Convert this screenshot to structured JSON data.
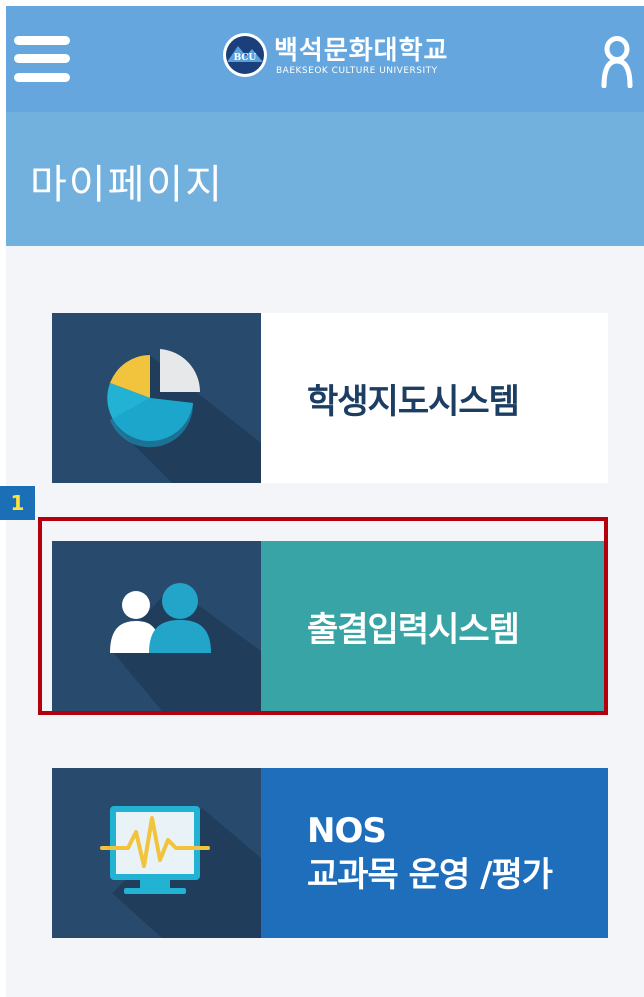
{
  "header": {
    "logo_name": "백석문화대학교",
    "logo_sub": "BAEKSEOK CULTURE UNIVERSITY",
    "logo_emblem_text": "BCU",
    "menu_icon": "hamburger-menu-icon",
    "user_icon": "user-profile-icon"
  },
  "page": {
    "title": "마이페이지"
  },
  "cards": [
    {
      "label": "학생지도시스템",
      "icon": "pie-chart-icon",
      "color": "#ffffff"
    },
    {
      "label": "출결입력시스템",
      "icon": "people-icon",
      "color": "#39a4a5"
    },
    {
      "label_line1": "NOS",
      "label_line2": "교과목 운영 /평가",
      "icon": "monitor-heartbeat-icon",
      "color": "#1f6ebb"
    }
  ],
  "annotation": {
    "marker": "1",
    "highlight_color": "#b4000c"
  },
  "colors": {
    "header_bg": "#64a6dd",
    "title_bg": "#72b0dd",
    "card_icon_bg": "#284a6c"
  }
}
